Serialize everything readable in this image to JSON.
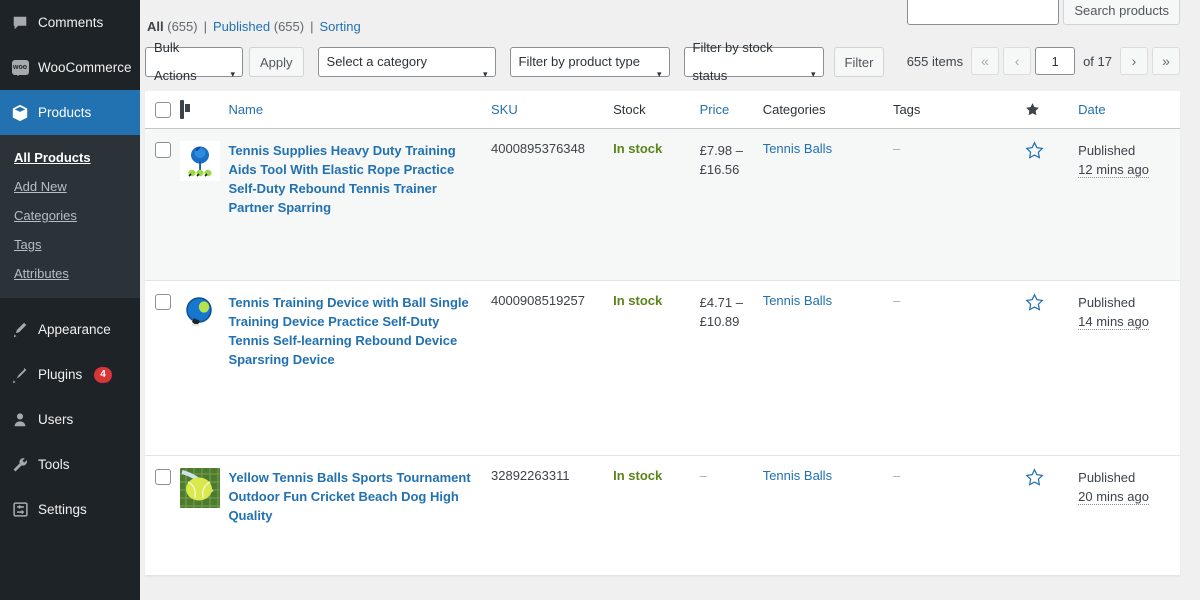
{
  "sidebar": {
    "items": [
      {
        "label": "Comments",
        "icon": "comment-icon",
        "current": false
      },
      {
        "label": "WooCommerce",
        "icon": "woocommerce-icon",
        "current": false
      },
      {
        "label": "Products",
        "icon": "products-box-icon",
        "current": true
      }
    ],
    "submenu": [
      {
        "label": "All Products",
        "active": true
      },
      {
        "label": "Add New",
        "active": false
      },
      {
        "label": "Categories",
        "active": false
      },
      {
        "label": "Tags",
        "active": false
      },
      {
        "label": "Attributes",
        "active": false
      }
    ],
    "items_bottom": [
      {
        "label": "Appearance",
        "icon": "brush-icon",
        "badge": ""
      },
      {
        "label": "Plugins",
        "icon": "plug-icon",
        "badge": "4"
      },
      {
        "label": "Users",
        "icon": "user-icon",
        "badge": ""
      },
      {
        "label": "Tools",
        "icon": "wrench-icon",
        "badge": ""
      },
      {
        "label": "Settings",
        "icon": "settings-sliders-icon",
        "badge": ""
      }
    ]
  },
  "views": {
    "all_label": "All",
    "all_count": "(655)",
    "published_label": "Published",
    "published_count": "(655)",
    "sorting_label": "Sorting",
    "divider": "|"
  },
  "toolbar": {
    "bulk_actions": "Bulk Actions",
    "apply_label": "Apply",
    "category_select": "Select a category",
    "product_type_select": "Filter by product type",
    "stock_status_select": "Filter by stock status",
    "filter_label": "Filter",
    "caret": "▾"
  },
  "search": {
    "value": "",
    "placeholder": "",
    "button_label": "Search products"
  },
  "pagination": {
    "items_label": "655 items",
    "first": "«",
    "prev": "‹",
    "current_page": "1",
    "of_total": "of 17",
    "next": "›",
    "last": "»"
  },
  "table": {
    "columns": [
      {
        "key": "cb",
        "label": ""
      },
      {
        "key": "image",
        "label": "",
        "icon": "media-image-icon"
      },
      {
        "key": "name",
        "label": "Name",
        "link": true
      },
      {
        "key": "sku",
        "label": "SKU",
        "link": true
      },
      {
        "key": "stock",
        "label": "Stock",
        "link": false
      },
      {
        "key": "price",
        "label": "Price",
        "link": true
      },
      {
        "key": "categories",
        "label": "Categories",
        "link": false
      },
      {
        "key": "tags",
        "label": "Tags",
        "link": false
      },
      {
        "key": "featured",
        "label": "",
        "icon": "star-filled-icon"
      },
      {
        "key": "date",
        "label": "Date",
        "link": true
      }
    ],
    "rows": [
      {
        "name": "Tennis Supplies Heavy Duty Training Aids Tool With Elastic Rope Practice Self-Duty Rebound Tennis Trainer Partner Sparring",
        "sku": "4000895376348",
        "stock": "In stock",
        "price": "£7.98 – £16.56",
        "categories": "Tennis Balls",
        "tags": "–",
        "featured": false,
        "date_status": "Published",
        "date_relative": "12 mins ago",
        "thumb": "blue-rebound-trainer"
      },
      {
        "name": "Tennis Training Device with Ball Single Training Device Practice Self-Duty Tennis Self-learning Rebound Device Sparsring Device",
        "sku": "4000908519257",
        "stock": "In stock",
        "price": "£4.71 – £10.89",
        "categories": "Tennis Balls",
        "tags": "–",
        "featured": false,
        "date_status": "Published",
        "date_relative": "14 mins ago",
        "thumb": "blue-trainer-ball"
      },
      {
        "name": "Yellow Tennis Balls Sports Tournament Outdoor Fun Cricket Beach Dog High Quality",
        "sku": "32892263311",
        "stock": "In stock",
        "price": "–",
        "categories": "Tennis Balls",
        "tags": "–",
        "featured": false,
        "date_status": "Published",
        "date_relative": "20 mins ago",
        "thumb": "yellow-ball-net"
      }
    ]
  },
  "colors": {
    "sidebar_bg": "#1d2327",
    "accent_blue": "#2271b1",
    "instock_green": "#5b841b",
    "badge_red": "#d63638",
    "notice_accent": "#c3a0c0"
  }
}
